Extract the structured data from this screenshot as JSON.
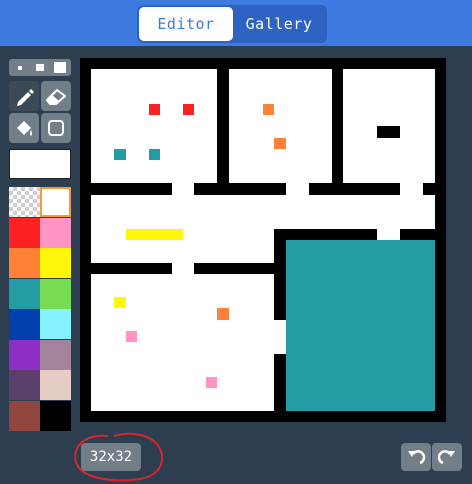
{
  "tabs": [
    {
      "label": "Editor",
      "active": true
    },
    {
      "label": "Gallery",
      "active": false
    }
  ],
  "tools": {
    "brush_sizes": [
      "small",
      "medium",
      "large"
    ],
    "items": [
      {
        "icon": "pencil-icon",
        "active": true
      },
      {
        "icon": "eraser-icon",
        "active": false
      },
      {
        "icon": "fill-bucket-icon",
        "active": false
      },
      {
        "icon": "rectangle-icon",
        "active": false
      }
    ]
  },
  "current_color": "#ffffff",
  "palette": [
    "transparent",
    "#ffffff",
    "#ff2121",
    "#ff93c4",
    "#ff8135",
    "#fff609",
    "#249ca3",
    "#78dc52",
    "#003fad",
    "#87f2ff",
    "#8e2ec4",
    "#a4839f",
    "#5c406c",
    "#e5cdc4",
    "#91463d",
    "#000000"
  ],
  "selected_palette_index": 1,
  "canvas": {
    "columns": 32,
    "rows": 32,
    "background": "#000000",
    "rects": [
      {
        "col": 1,
        "row": 1,
        "w": 11,
        "h": 10,
        "color": "#ffffff"
      },
      {
        "col": 13,
        "row": 1,
        "w": 9,
        "h": 10,
        "color": "#ffffff"
      },
      {
        "col": 23,
        "row": 1,
        "w": 8,
        "h": 5,
        "color": "#ffffff"
      },
      {
        "col": 23,
        "row": 6,
        "w": 3,
        "h": 1,
        "color": "#ffffff"
      },
      {
        "col": 28,
        "row": 6,
        "w": 3,
        "h": 1,
        "color": "#ffffff"
      },
      {
        "col": 23,
        "row": 7,
        "w": 8,
        "h": 4,
        "color": "#ffffff"
      },
      {
        "col": 8,
        "row": 11,
        "w": 2,
        "h": 1,
        "color": "#ffffff"
      },
      {
        "col": 18,
        "row": 11,
        "w": 2,
        "h": 1,
        "color": "#ffffff"
      },
      {
        "col": 28,
        "row": 11,
        "w": 2,
        "h": 1,
        "color": "#ffffff"
      },
      {
        "col": 1,
        "row": 12,
        "w": 30,
        "h": 3,
        "color": "#ffffff"
      },
      {
        "col": 1,
        "row": 15,
        "w": 16,
        "h": 3,
        "color": "#ffffff"
      },
      {
        "col": 26,
        "row": 15,
        "w": 2,
        "h": 1,
        "color": "#ffffff"
      },
      {
        "col": 8,
        "row": 18,
        "w": 2,
        "h": 1,
        "color": "#ffffff"
      },
      {
        "col": 1,
        "row": 19,
        "w": 16,
        "h": 12,
        "color": "#ffffff"
      },
      {
        "col": 17,
        "row": 23,
        "w": 1,
        "h": 3,
        "color": "#ffffff"
      },
      {
        "col": 18,
        "row": 16,
        "w": 13,
        "h": 15,
        "color": "#249ca3"
      },
      {
        "col": 6,
        "row": 4,
        "w": 1,
        "h": 1,
        "color": "#ff2121"
      },
      {
        "col": 9,
        "row": 4,
        "w": 1,
        "h": 1,
        "color": "#ff2121"
      },
      {
        "col": 3,
        "row": 8,
        "w": 1,
        "h": 1,
        "color": "#249ca3"
      },
      {
        "col": 6,
        "row": 8,
        "w": 1,
        "h": 1,
        "color": "#249ca3"
      },
      {
        "col": 16,
        "row": 4,
        "w": 1,
        "h": 1,
        "color": "#ff8135"
      },
      {
        "col": 17,
        "row": 7,
        "w": 1,
        "h": 1,
        "color": "#ff8135"
      },
      {
        "col": 4,
        "row": 15,
        "w": 5,
        "h": 1,
        "color": "#fff609"
      },
      {
        "col": 3,
        "row": 21,
        "w": 1,
        "h": 1,
        "color": "#fff609"
      },
      {
        "col": 12,
        "row": 22,
        "w": 1,
        "h": 1,
        "color": "#ff8135"
      },
      {
        "col": 4,
        "row": 24,
        "w": 1,
        "h": 1,
        "color": "#ff93c4"
      },
      {
        "col": 11,
        "row": 28,
        "w": 1,
        "h": 1,
        "color": "#ff93c4"
      }
    ]
  },
  "size_label": "32x32",
  "actions": [
    "undo-icon",
    "redo-icon"
  ]
}
